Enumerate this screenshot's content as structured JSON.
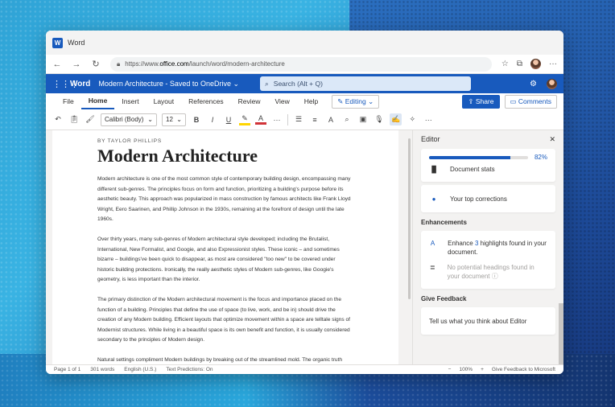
{
  "window": {
    "title": "Word"
  },
  "browser": {
    "url_prefix": "https://www.",
    "url_domain": "office.com",
    "url_path": "/launch/word/modern-architecture"
  },
  "appbar": {
    "app_name": "Word",
    "doc_name": "Modern Architecture - Saved to OneDrive",
    "search_placeholder": "Search (Alt + Q)"
  },
  "ribbon": {
    "tabs": [
      "File",
      "Home",
      "Insert",
      "Layout",
      "References",
      "Review",
      "View",
      "Help"
    ],
    "editing_label": "Editing",
    "share_label": "Share",
    "comments_label": "Comments"
  },
  "toolbar": {
    "font": "Calibri (Body)",
    "size": "12",
    "bold": "B",
    "italic": "I",
    "underline": "U"
  },
  "document": {
    "byline": "BY TAYLOR PHILLIPS",
    "title": "Modern Architecture",
    "paragraphs": [
      "Modern architecture is one of the most common style of contemporary building design, encompassing many different sub-genres. The principles focus on form and function, prioritizing a building's purpose before its aesthetic beauty. This approach was popularized in mass construction by famous architects like Frank Lloyd Wright, Eero Saarinen, and Phillip Johnson in the 1930s, remaining at the forefront of design until the late 1960s.",
      "Over thirty years, many sub-genres of Modern architectural style developed; including the Brutalist, International, New Formalist, and Googie, and also Expressionist styles. These iconic – and sometimes bizarre – buildings've been quick to disappear, as most are considered \"too new\" to be covered under historic building protections. Ironically, the really aesthetic styles of Modern sub-genres, like Googie's geometry, is less important than the interior.",
      "The primary distinction of the Modern architectural movement is the focus and importance placed on the function of a building. Principles that define the use of space (to live, work, and be in) should drive the creation of any Modern building. Efficient layouts that optimize movement within a space are telltale signs of Modernist structures. While living in a beautiful space is its own benefit and function, it is usually considered secondary to the principles of Modern design.",
      "Natural settings compliment Modern buildings by breaking out of the streamlined mold. The organic truth"
    ]
  },
  "editor": {
    "title": "Editor",
    "score": "82%",
    "score_fraction": 0.82,
    "items": [
      "Document stats",
      "Your top corrections"
    ],
    "enhancements_title": "Enhancements",
    "enh1_pre": "Enhance ",
    "enh1_num": "3",
    "enh1_post": " highlights found in your document.",
    "enh2": "No potential headings found in your document",
    "feedback_title": "Give Feedback",
    "feedback_text": "Tell us what you think about Editor"
  },
  "status": {
    "page": "Page 1 of 1",
    "words": "301 words",
    "lang": "English (U.S.)",
    "predictions": "Text Predictions: On",
    "zoom": "100%",
    "feedback": "Give Feedback to Microsoft"
  }
}
